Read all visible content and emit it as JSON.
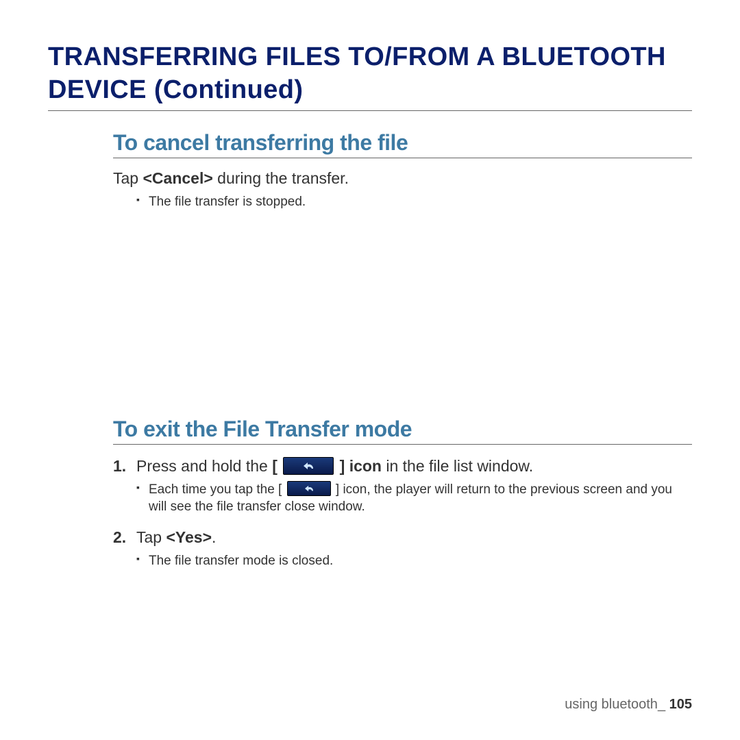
{
  "heading": "TRANSFERRING FILES TO/FROM A BLUETOOTH DEVICE (Continued)",
  "section1": {
    "title": "To cancel transferring the file",
    "line1_pre": "Tap ",
    "line1_bold": "<Cancel>",
    "line1_post": " during the transfer.",
    "bullet": "The file transfer is stopped."
  },
  "section2": {
    "title": "To exit the File Transfer mode",
    "step1_num": "1.",
    "step1_pre": "Press and hold the ",
    "step1_lbracket": "[ ",
    "step1_rbracket": " ] ",
    "step1_bold": "icon",
    "step1_post": " in the file list window.",
    "step1_bullet_pre": "Each time you tap the [ ",
    "step1_bullet_post": " ] icon, the player will return to the previous screen and you will see the file transfer close window.",
    "step2_num": "2.",
    "step2_pre": "Tap ",
    "step2_bold": "<Yes>",
    "step2_post": ".",
    "step2_bullet": "The file transfer mode is closed."
  },
  "footer": {
    "section": "using bluetooth",
    "sep": "_ ",
    "page": "105"
  }
}
